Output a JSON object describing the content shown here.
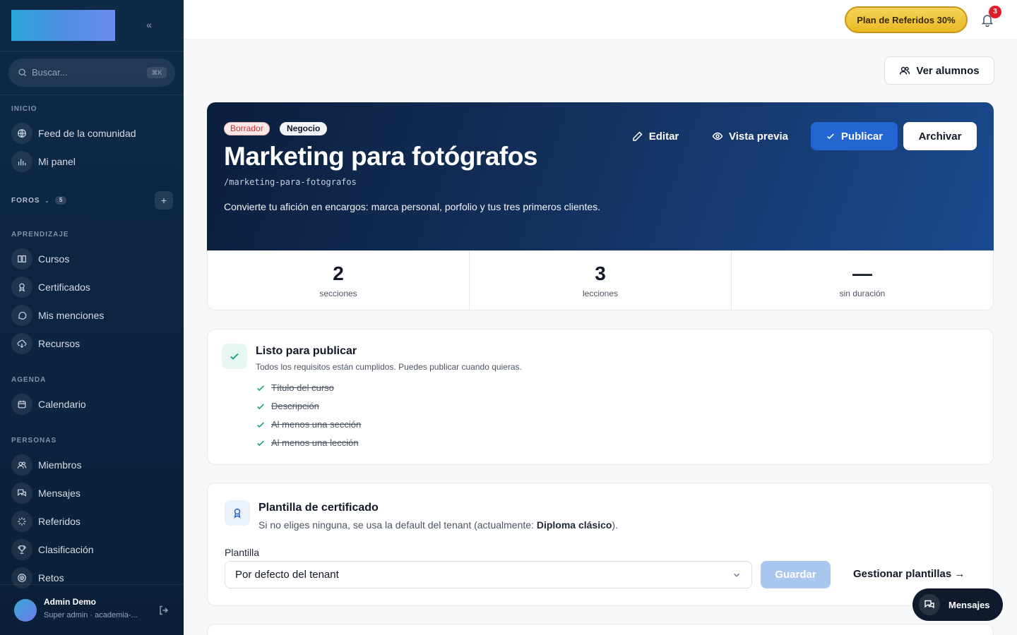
{
  "sidebar": {
    "search": {
      "placeholder": "Buscar...",
      "shortcut": "⌘K"
    },
    "sections": {
      "inicio": "INICIO",
      "foros": "FOROS",
      "foros_count": "5",
      "aprendizaje": "APRENDIZAJE",
      "agenda": "AGENDA",
      "personas": "PERSONAS"
    },
    "items": {
      "feed": "Feed de la comunidad",
      "panel": "Mi panel",
      "cursos": "Cursos",
      "certificados": "Certificados",
      "menciones": "Mis menciones",
      "recursos": "Recursos",
      "calendario": "Calendario",
      "miembros": "Miembros",
      "mensajes": "Mensajes",
      "referidos": "Referidos",
      "clasificacion": "Clasificación",
      "retos": "Retos"
    },
    "user": {
      "name": "Admin Demo",
      "role": "Super admin · academia-..."
    }
  },
  "topbar": {
    "referral": "Plan de Referidos 30%",
    "notifications": "3"
  },
  "main": {
    "ver_alumnos": "Ver alumnos",
    "course": {
      "status": "Borrador",
      "category": "Negocio",
      "title": "Marketing para fotógrafos",
      "slug": "/marketing-para-fotografos",
      "description": "Convierte tu afición en encargos: marca personal, porfolio y tus tres primeros clientes."
    },
    "actions": {
      "edit": "Editar",
      "preview": "Vista previa",
      "publish": "Publicar",
      "archive": "Archivar"
    },
    "stats": [
      {
        "value": "2",
        "label": "secciones"
      },
      {
        "value": "3",
        "label": "lecciones"
      },
      {
        "value": "—",
        "label": "sin duración"
      }
    ],
    "ready": {
      "title": "Listo para publicar",
      "subtitle": "Todos los requisitos están cumplidos. Puedes publicar cuando quieras.",
      "requirements": [
        "Título del curso",
        "Descripción",
        "Al menos una sección",
        "Al menos una lección"
      ]
    },
    "certificate": {
      "title": "Plantilla de certificado",
      "subtitle_before": "Si no eliges ninguna, se usa la default del tenant (actualmente: ",
      "subtitle_bold": "Diploma clásico",
      "subtitle_after": ").",
      "field_label": "Plantilla",
      "selected": "Por defecto del tenant",
      "save": "Guardar",
      "manage": "Gestionar plantillas →"
    }
  },
  "messages_fab": "Mensajes",
  "colors": {
    "accent": "#2366d1",
    "sidebar": "#0b2440",
    "success": "#0f9f7a",
    "danger": "#e11d2a"
  }
}
